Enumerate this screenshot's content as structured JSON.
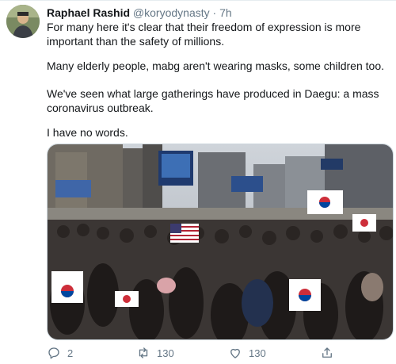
{
  "tweet": {
    "author_name": "Raphael Rashid",
    "author_handle": "@koryodynasty",
    "separator": "·",
    "time": "7h",
    "paragraphs": [
      "For many here it's clear that their freedom of expression is more important than the safety of millions.",
      "Many elderly people, mabg aren't wearing masks, some children too.",
      "We've seen what large gatherings have produced in Daegu: a mass coronavirus outbreak.",
      "I have no words."
    ]
  },
  "actions": {
    "reply_count": "2",
    "retweet_count": "130",
    "like_count": "130"
  },
  "icons": {
    "reply": "reply-icon",
    "retweet": "retweet-icon",
    "like": "heart-icon",
    "share": "share-icon"
  },
  "colors": {
    "secondary_text": "#657786",
    "primary_text": "#14171a"
  }
}
